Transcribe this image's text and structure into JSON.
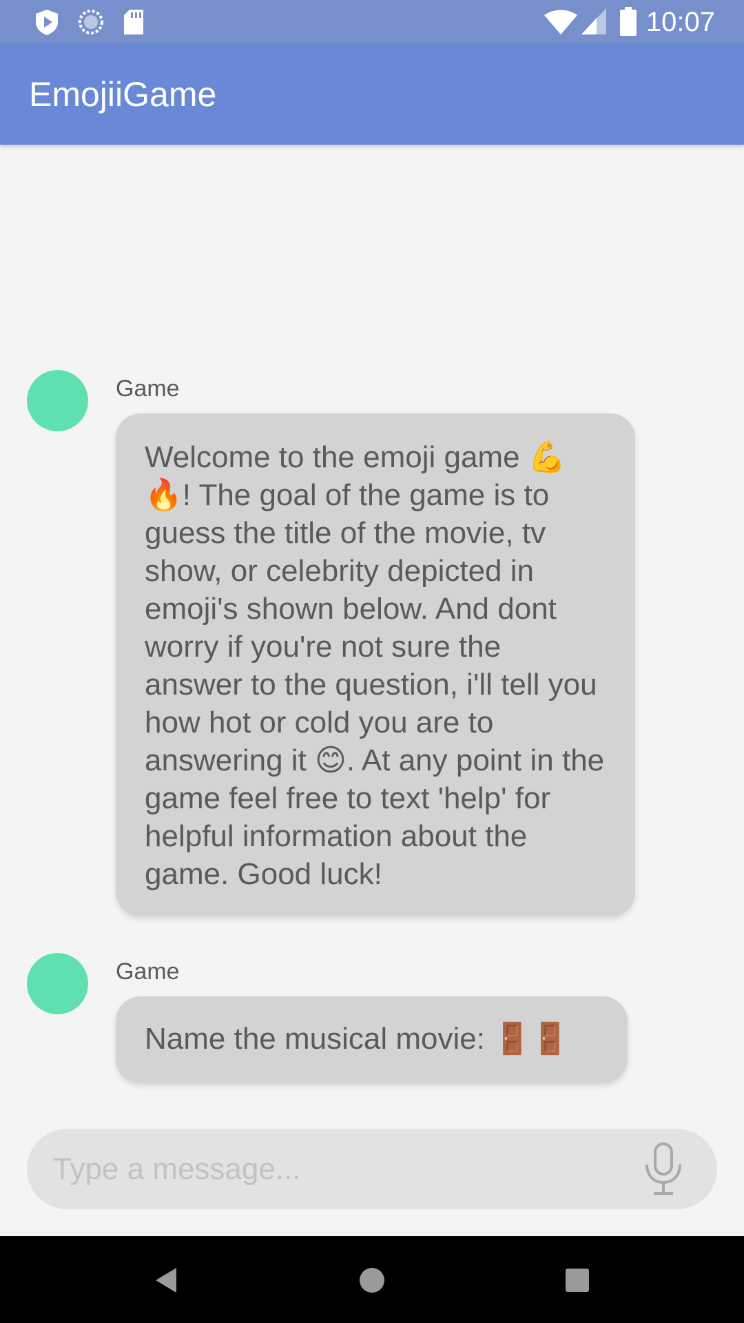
{
  "status_bar": {
    "time": "10:07",
    "left_icons": [
      "shield-play-icon",
      "sync-circle-icon",
      "sd-card-icon"
    ],
    "right_icons": [
      "wifi-icon",
      "cell-signal-icon",
      "battery-icon"
    ]
  },
  "app_bar": {
    "title": "EmojiiGame"
  },
  "messages": [
    {
      "sender": "Game",
      "text": "Welcome to the emoji game 💪🔥! The goal of the game is to guess the title of the movie, tv show, or celebrity depicted in emoji's shown below. And dont worry if you're not sure the answer to the question, i'll tell you how hot or cold you are to answering it 😊. At any point in the game feel free to text 'help' for helpful information about the game. Good luck!"
    },
    {
      "sender": "Game",
      "text": "Name the musical movie: 🚪🚪"
    }
  ],
  "composer": {
    "placeholder": "Type a message...",
    "mic_icon": "microphone-icon"
  },
  "nav_bar": {
    "icons": [
      "back-icon",
      "home-icon",
      "recents-icon"
    ]
  },
  "colors": {
    "status_bar": "#778fcb",
    "app_bar": "#6989d7",
    "avatar": "#5ee1ae",
    "bubble": "#d3d3d3",
    "background": "#f4f4f4"
  }
}
